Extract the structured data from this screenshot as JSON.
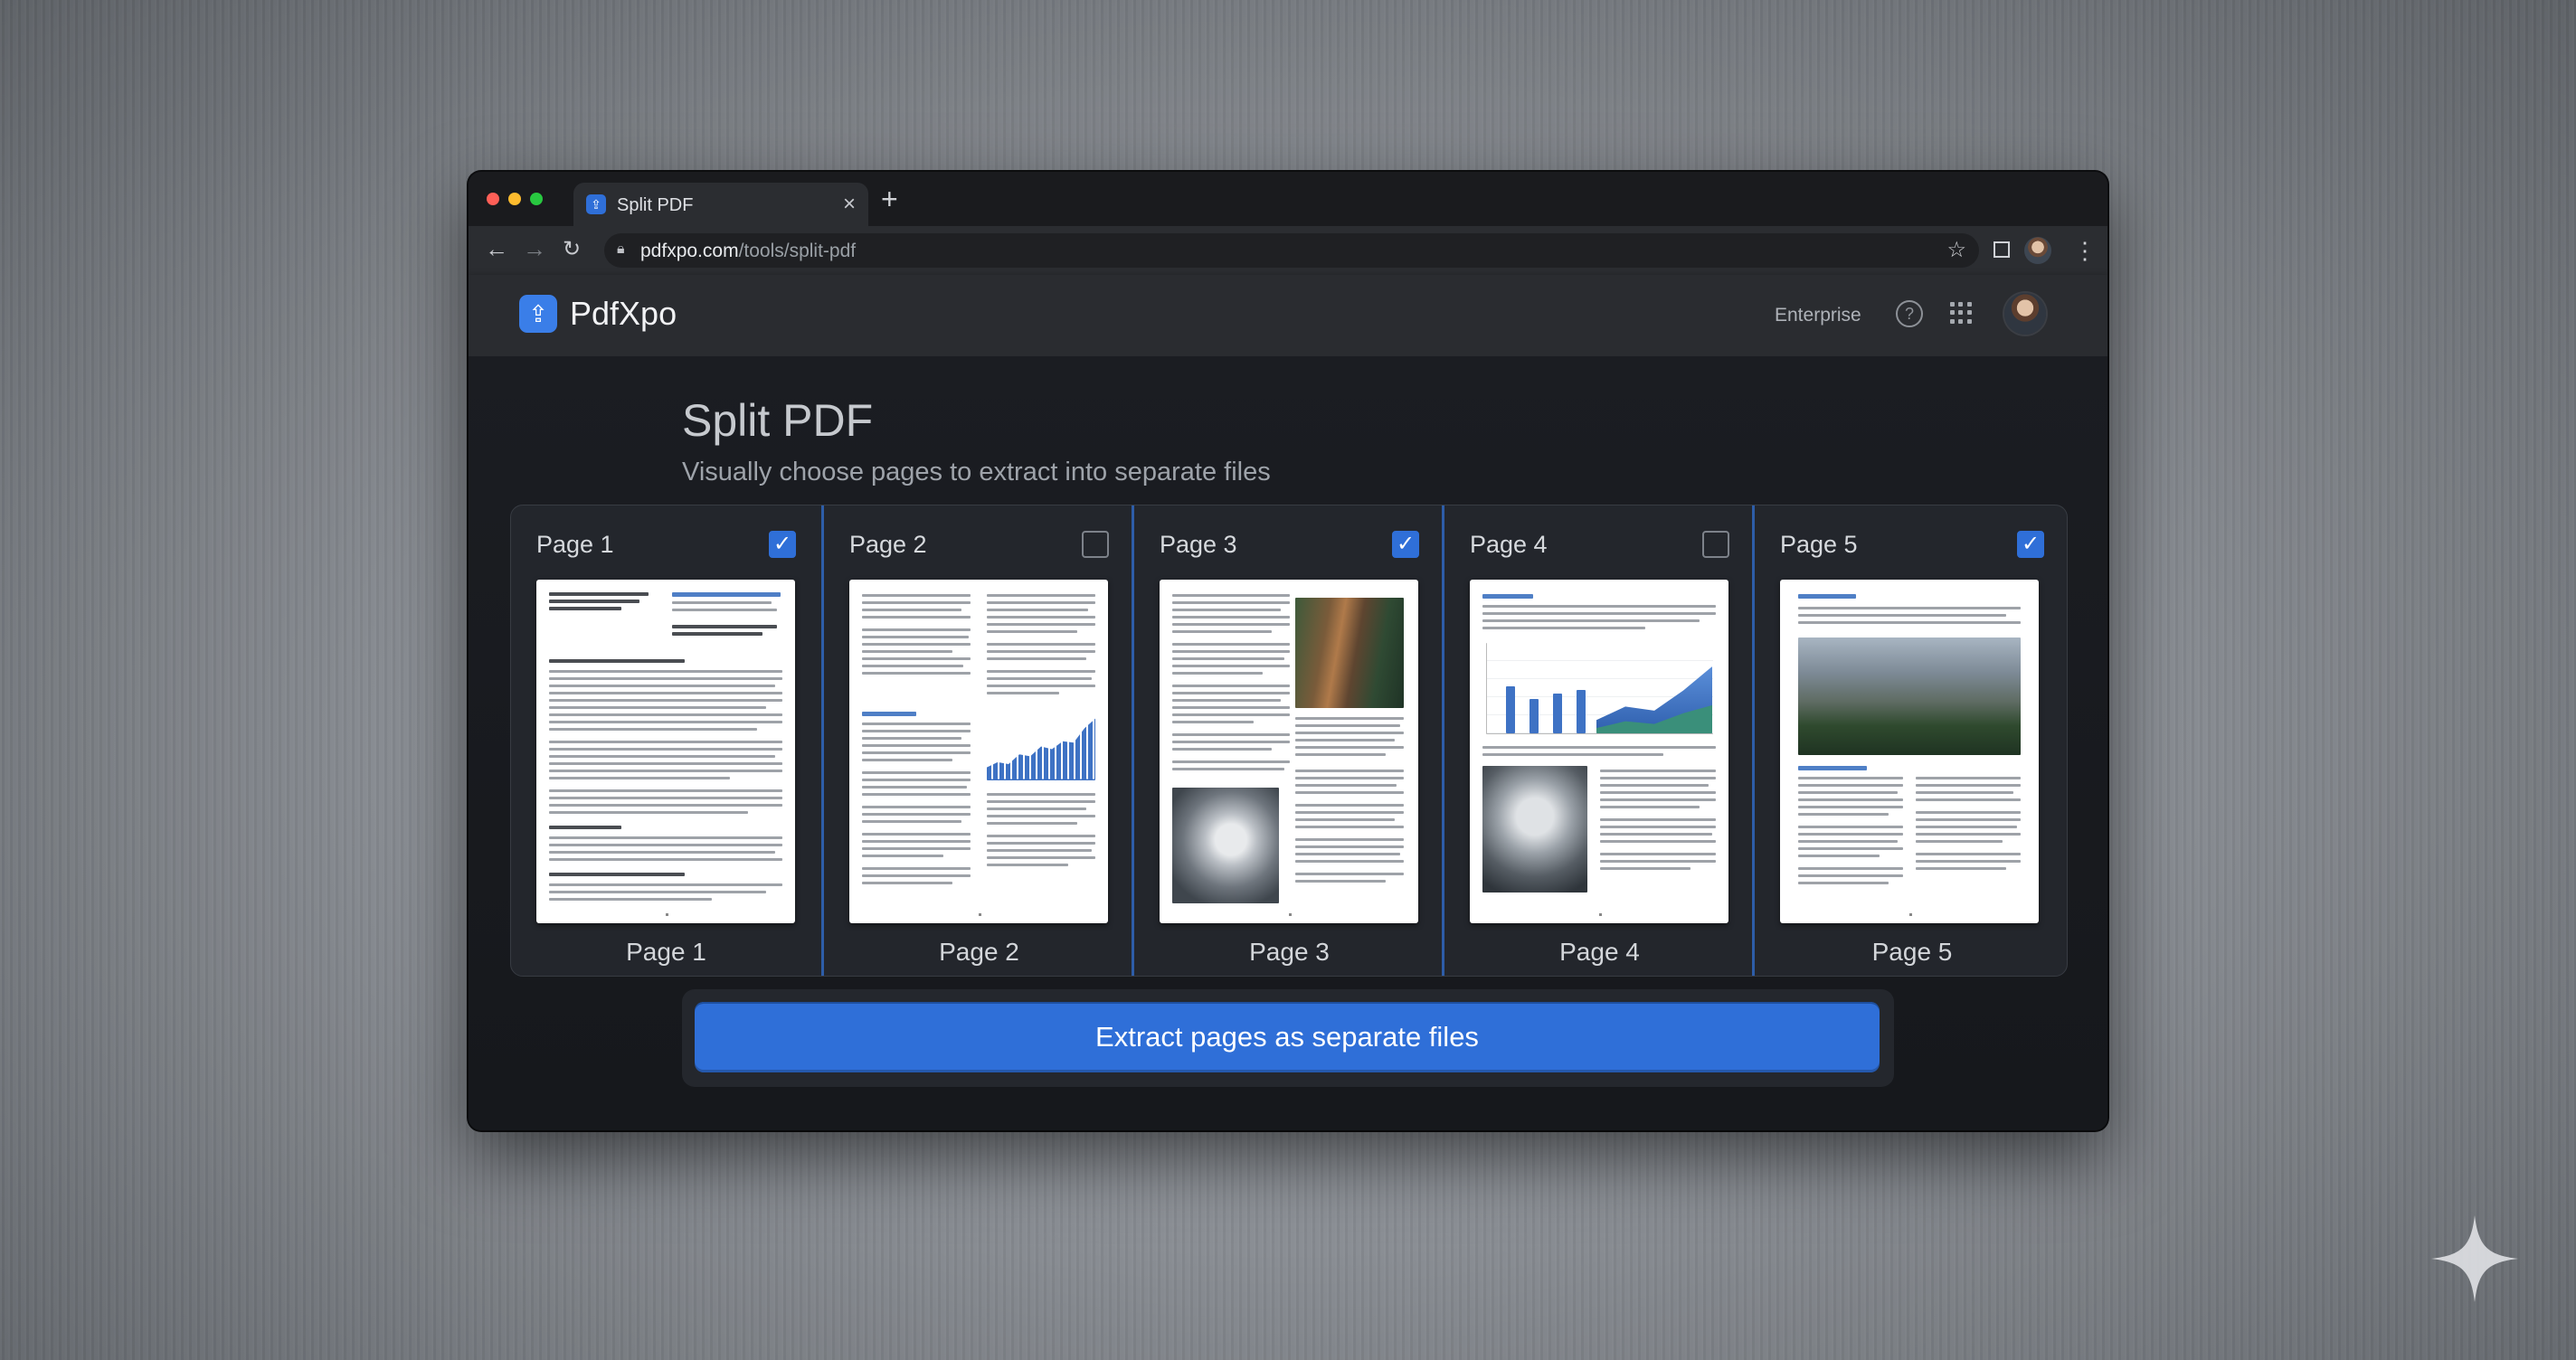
{
  "browser": {
    "tab_title": "Split PDF",
    "url_host": "pdfxpo.com",
    "url_path": "/tools/split-pdf"
  },
  "app": {
    "brand": "PdfXpo",
    "nav": {
      "enterprise": "Enterprise"
    }
  },
  "page": {
    "title": "Split PDF",
    "subtitle": "Visually choose pages to extract into separate files"
  },
  "pages": [
    {
      "label": "Page 1",
      "caption": "Page 1",
      "selected": true
    },
    {
      "label": "Page 2",
      "caption": "Page 2",
      "selected": false
    },
    {
      "label": "Page 3",
      "caption": "Page 3",
      "selected": true
    },
    {
      "label": "Page 4",
      "caption": "Page 4",
      "selected": false
    },
    {
      "label": "Page 5",
      "caption": "Page 5",
      "selected": true
    }
  ],
  "actions": {
    "extract_label": "Extract pages as separate files"
  },
  "icons": {
    "favicon": "pdfxpo-logo-icon",
    "close": "close-icon",
    "new_tab": "plus-icon",
    "back": "arrow-left-icon",
    "forward": "arrow-right-icon",
    "reload": "reload-icon",
    "lock": "lock-icon",
    "bookmark": "star-icon",
    "help": "help-icon",
    "apps": "apps-grid-icon",
    "checkbox": "checkmark-icon"
  },
  "colors": {
    "accent": "#2f6fd8",
    "window_bg": "#1c1e22",
    "panel_bg": "#23262c"
  }
}
